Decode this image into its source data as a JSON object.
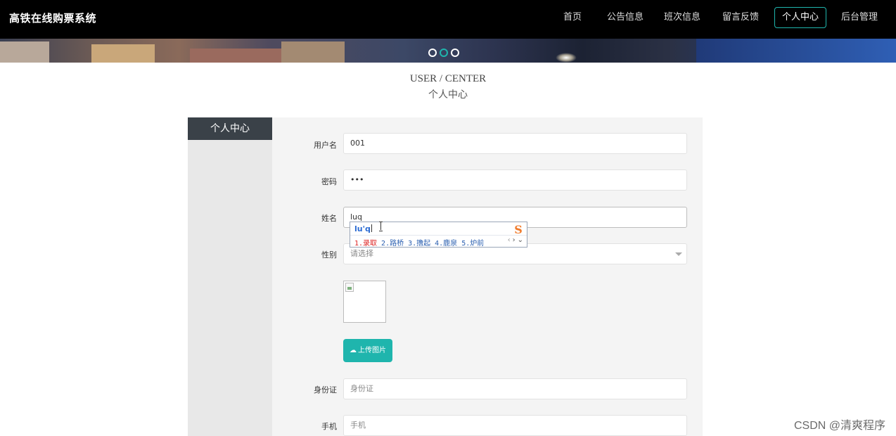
{
  "header": {
    "brand": "高铁在线购票系统",
    "nav": [
      {
        "label": "首页",
        "active": false
      },
      {
        "label": "公告信息",
        "active": false
      },
      {
        "label": "班次信息",
        "active": false
      },
      {
        "label": "留言反馈",
        "active": false
      },
      {
        "label": "个人中心",
        "active": true
      },
      {
        "label": "后台管理",
        "active": false
      }
    ],
    "accent_color": "#1fb5ad"
  },
  "banner": {
    "slides": 3,
    "active_slide": 2
  },
  "page": {
    "title_en": "USER / CENTER",
    "title_cn": "个人中心"
  },
  "sidebar": {
    "items": [
      {
        "label": "个人中心"
      }
    ]
  },
  "form": {
    "username": {
      "label": "用户名",
      "value": "001"
    },
    "password": {
      "label": "密码",
      "value": "•••"
    },
    "name": {
      "label": "姓名",
      "value": "luq"
    },
    "gender": {
      "label": "性别",
      "placeholder": "请选择"
    },
    "upload_button": "上传图片",
    "id_card": {
      "label": "身份证",
      "placeholder": "身份证"
    },
    "phone": {
      "label": "手机",
      "placeholder": "手机"
    }
  },
  "ime": {
    "composition": "lu'q",
    "candidates": [
      "1.录取",
      "2.路桥",
      "3.撸起",
      "4.鹿泉",
      "5.炉前"
    ],
    "logo_icon": "sogou-s-icon"
  },
  "watermark": "CSDN @清爽程序"
}
